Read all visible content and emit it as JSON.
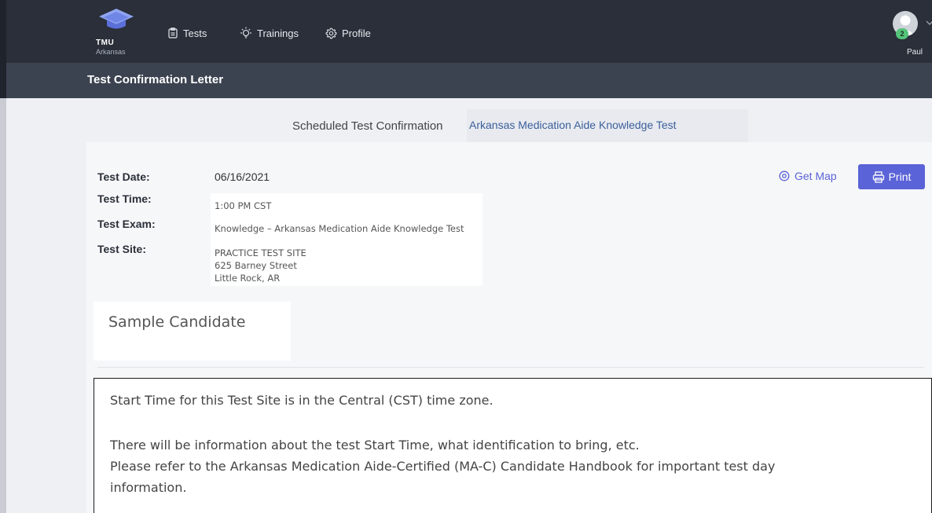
{
  "nav": {
    "brand": "TMU",
    "brand_sub": "Arkansas",
    "items": [
      {
        "label": "Tests",
        "icon": "clipboard-icon"
      },
      {
        "label": "Trainings",
        "icon": "bulb-icon"
      },
      {
        "label": "Profile",
        "icon": "gear-icon"
      }
    ],
    "user": {
      "name": "Paul",
      "badge": "2"
    }
  },
  "page_title": "Test Confirmation Letter",
  "scheduled": {
    "label": "Scheduled Test Confirmation",
    "test_name": "Arkansas Medication Aide Knowledge Test"
  },
  "details": {
    "date_label": "Test Date:",
    "date": "06/16/2021",
    "time_label": "Test Time:",
    "time": "1:00 PM CST",
    "exam_label": "Test Exam:",
    "exam": "Knowledge – Arkansas Medication Aide Knowledge Test",
    "site_label": "Test Site:",
    "site_name": "PRACTICE TEST SITE",
    "site_street": "625 Barney Street",
    "site_city": "Little Rock, AR"
  },
  "actions": {
    "get_map": "Get Map",
    "print": "Print"
  },
  "candidate": "Sample Candidate",
  "notes": {
    "line1": "Start Time for this Test Site is in the Central (CST) time zone.",
    "line2": "There will be information about the test Start Time, what identification to bring, etc.",
    "line3": "Please refer to the Arkansas Medication Aide-Certified (MA-C) Candidate Handbook for important test day",
    "line4": "information."
  },
  "colors": {
    "nav_bg": "#2a2f39",
    "title_bg": "#3c4350",
    "accent": "#5b63d8",
    "link": "#3b5f9c"
  }
}
